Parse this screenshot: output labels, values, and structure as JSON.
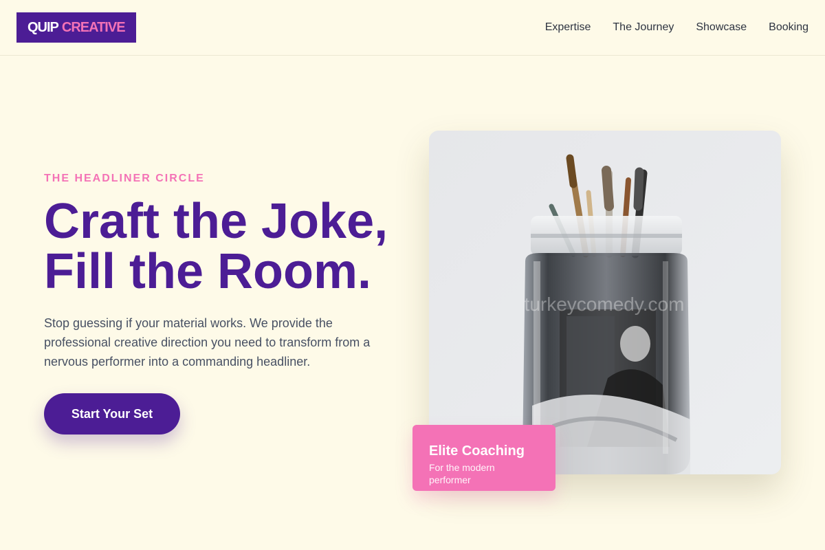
{
  "header": {
    "logo_primary": "QUIP",
    "logo_accent": "CREATIVE",
    "nav": [
      {
        "label": "Expertise"
      },
      {
        "label": "The Journey"
      },
      {
        "label": "Showcase"
      },
      {
        "label": "Booking"
      }
    ]
  },
  "hero": {
    "eyebrow": "THE HEADLINER CIRCLE",
    "headline_line1": "Craft the Joke,",
    "headline_line2": "Fill the Room.",
    "description": "Stop guessing if your material works. We provide the professional creative direction you need to transform from a nervous performer into a commanding headliner.",
    "cta_label": "Start Your Set"
  },
  "image": {
    "subject": "glass jar with paintbrushes holding a black and white photograph",
    "watermark": "turkeycomedy.com"
  },
  "badge": {
    "title": "Elite Coaching",
    "subtitle": "For the modern performer"
  },
  "colors": {
    "background": "#fefae8",
    "brand_purple": "#4c1d95",
    "brand_pink": "#f472b6",
    "body_text": "#475063"
  }
}
